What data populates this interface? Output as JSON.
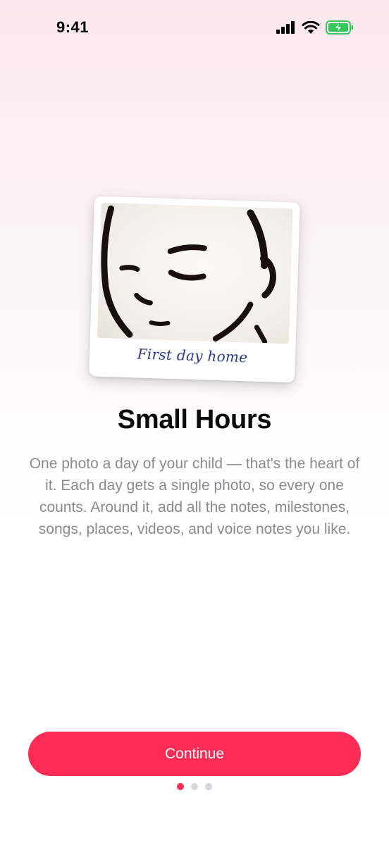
{
  "status_bar": {
    "time": "9:41",
    "icons": [
      "cellular-signal-icon",
      "wifi-icon",
      "battery-charging-icon"
    ]
  },
  "polaroid": {
    "caption": "First day home"
  },
  "title": "Small Hours",
  "description": "One photo a day of your child — that's the heart of it. Each day gets a single photo, so every one counts. Around it, add all the notes, milestones, songs, places, videos, and voice notes you like.",
  "continue_label": "Continue",
  "pagination": {
    "total": 3,
    "current": 1
  },
  "colors": {
    "accent": "#ff2d55",
    "caption": "#2a3a8a",
    "body_text": "#8a8a8f",
    "battery": "#34c759"
  }
}
